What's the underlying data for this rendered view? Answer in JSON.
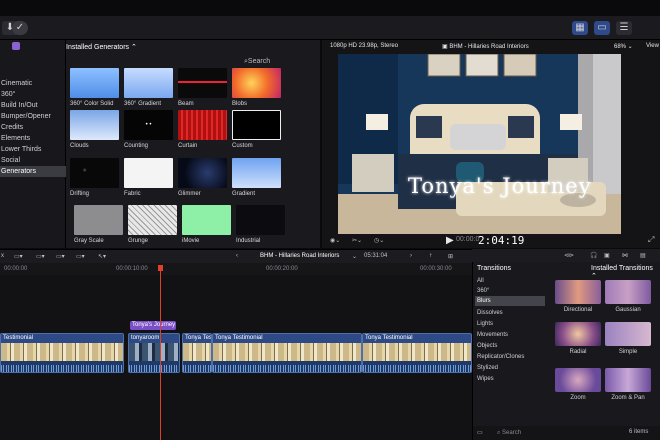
{
  "sidebar": {
    "items": [
      "Cinematic",
      "360°",
      "Build In/Out",
      "Bumper/Opener",
      "Credits",
      "Elements",
      "Lower Thirds",
      "Social",
      "Generators"
    ],
    "selected": "Generators"
  },
  "browser": {
    "title": "Installed Generators",
    "search_placeholder": "Search",
    "generators": [
      "360° Color Solid",
      "360° Gradient",
      "Beam",
      "Blobs",
      "Clouds",
      "Counting",
      "Curtain",
      "Custom",
      "Drifting",
      "Fabric",
      "Glimmer",
      "Gradient",
      "Gray Scale",
      "Grunge",
      "iMovie",
      "Industrial"
    ]
  },
  "viewer": {
    "format": "1080p HD 23.98p, Stereo",
    "project": "BHM - Hillaries Road Interiors",
    "zoom": "68%",
    "view_label": "View",
    "overlay_title": "Tonya's Journey",
    "timecode": "2:04:19",
    "timecode_prefix": "00:00:0"
  },
  "timeline": {
    "project": "BHM - Hillaries Road Interiors",
    "duration": "05:31:04",
    "ruler": [
      "00:00:00",
      "00:00:10:00",
      "00:00:20:00",
      "00:00:30:00"
    ],
    "title_clip": "Tonya's Journey",
    "clips": [
      "Testimonial",
      "tonyaroom",
      "Tonya Tes",
      "Tonya Testimonial",
      "Tonya Testimonial"
    ]
  },
  "transitions": {
    "title": "Transitions",
    "installed": "Installed Transitions",
    "categories": [
      "All",
      "360°",
      "Blurs",
      "Dissolves",
      "Lights",
      "Movements",
      "Objects",
      "Replicator/Clones",
      "Stylized",
      "Wipes"
    ],
    "selected": "Blurs",
    "items": [
      "Directional",
      "Gaussian",
      "Radial",
      "Simple",
      "Zoom",
      "Zoom & Pan"
    ],
    "search_placeholder": "Search",
    "count": "6 items"
  },
  "colors": {
    "accent": "#5b8cf5",
    "selection": "#3b3b42",
    "title_clip": "#7b4fc8"
  }
}
